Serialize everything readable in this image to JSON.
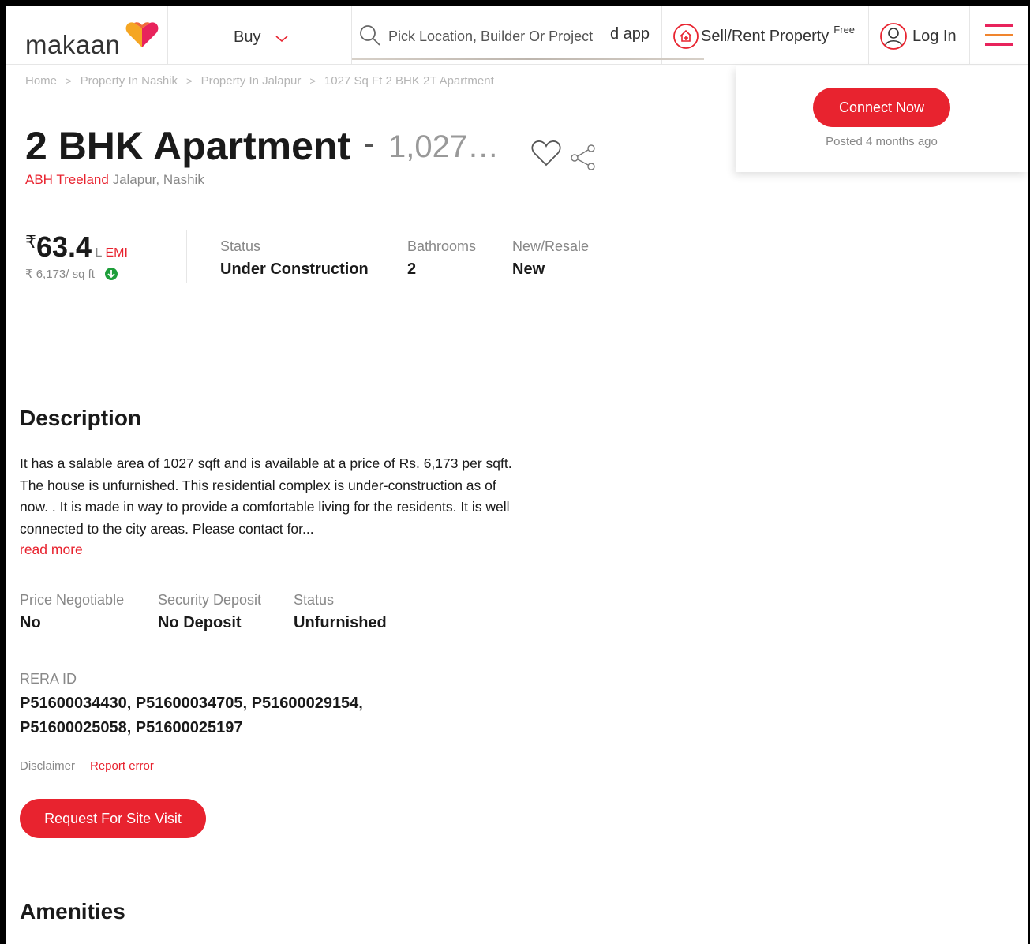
{
  "header": {
    "logo_text": "makaan",
    "buy_label": "Buy",
    "search_placeholder": "Pick Location, Builder Or Project",
    "app_link": "d app",
    "sell_label": "Sell/Rent Property",
    "sell_badge": "Free",
    "login_label": "Log In"
  },
  "card": {
    "connect_label": "Connect Now",
    "posted": "Posted 4 months ago"
  },
  "breadcrumb": [
    "Home",
    "Property In Nashik",
    "Property In Jalapur",
    "1027 Sq Ft 2 BHK 2T Apartment"
  ],
  "listing": {
    "title": "2 BHK Apartment",
    "dash": "-",
    "area": "1,027…",
    "project": "ABH Treeland",
    "locality": "Jalapur,",
    "city": "Nashik"
  },
  "price": {
    "symbol": "₹",
    "value": "63.4",
    "unit": "L",
    "emi": "EMI",
    "rate": "₹ 6,173/ sq ft"
  },
  "stats": {
    "status_label": "Status",
    "status_value": "Under Construction",
    "bathrooms_label": "Bathrooms",
    "bathrooms_value": "2",
    "newresale_label": "New/Resale",
    "newresale_value": "New"
  },
  "description": {
    "heading": "Description",
    "text": "It has a salable area of 1027 sqft and is available at a price of Rs. 6,173 per sqft. The house is unfurnished. This residential complex is under-construction as of now. . It is made in way to provide a comfortable living for the residents. It is well connected to the city areas. Please contact for...",
    "read_more": "read more"
  },
  "details": {
    "negotiable_label": "Price Negotiable",
    "negotiable_value": "No",
    "deposit_label": "Security Deposit",
    "deposit_value": "No Deposit",
    "furnish_label": "Status",
    "furnish_value": "Unfurnished",
    "rera_label": "RERA ID",
    "rera_value": "P51600034430, P51600034705, P51600029154, P51600025058, P51600025197"
  },
  "footer": {
    "disclaimer": "Disclaimer",
    "report_error": "Report error",
    "site_visit": "Request For Site Visit",
    "amenities_heading": "Amenities"
  },
  "colors": {
    "accent": "#e8232f",
    "logo_heart_orange": "#f5a623",
    "logo_heart_pink": "#e8235c",
    "price_down_green": "#1e9e3a"
  }
}
